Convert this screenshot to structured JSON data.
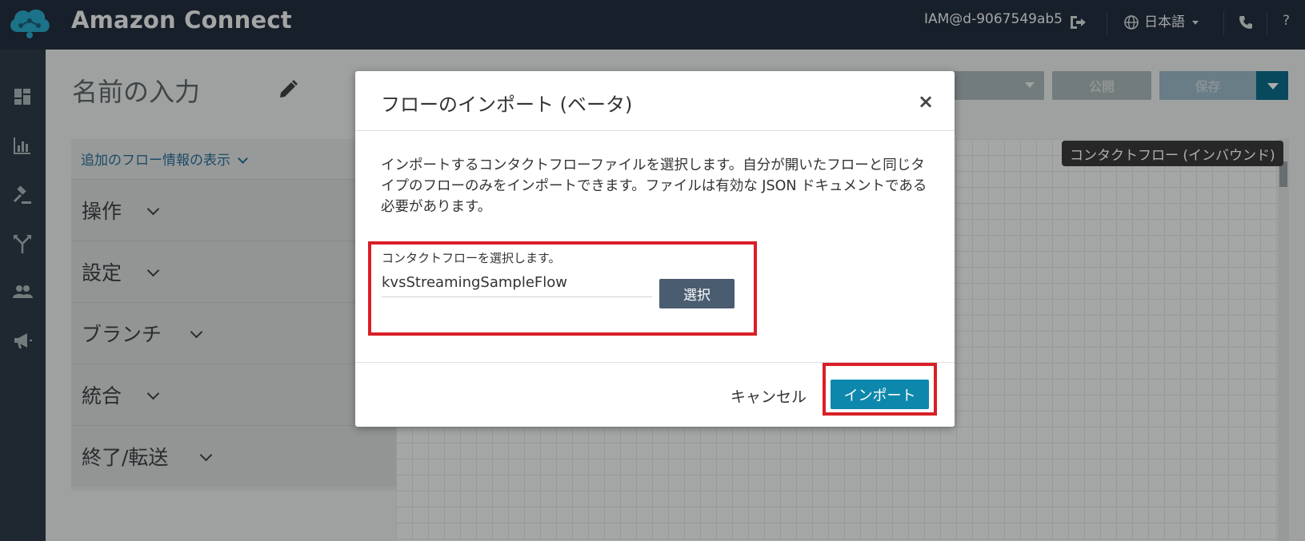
{
  "header": {
    "app_title": "Amazon Connect",
    "user": "IAM@d-9067549ab5",
    "language": "日本語",
    "help": "?"
  },
  "editor": {
    "flow_name": "名前の入力",
    "publish_label": "公開",
    "save_label": "保存",
    "tooltip": "コンタクトフロー (インバウンド)"
  },
  "panel": {
    "more_info": "追加のフロー情報の表示",
    "sections": [
      "操作",
      "設定",
      "ブランチ",
      "統合",
      "終了/転送"
    ]
  },
  "modal": {
    "title": "フローのインポート (ベータ)",
    "close": "×",
    "description": "インポートするコンタクトフローファイルを選択します。自分が開いたフローと同じタイプのフローのみをインポートできます。ファイルは有効な JSON ドキュメントである必要があります。",
    "field_label": "コンタクトフローを選択します。",
    "file_name": "kvsStreamingSampleFlow",
    "choose_label": "選択",
    "cancel_label": "キャンセル",
    "import_label": "インポート"
  },
  "colors": {
    "topbar": "#232f3e",
    "rail": "#2e3a48",
    "import_button": "#0e87ad",
    "highlight": "#d91f26"
  }
}
